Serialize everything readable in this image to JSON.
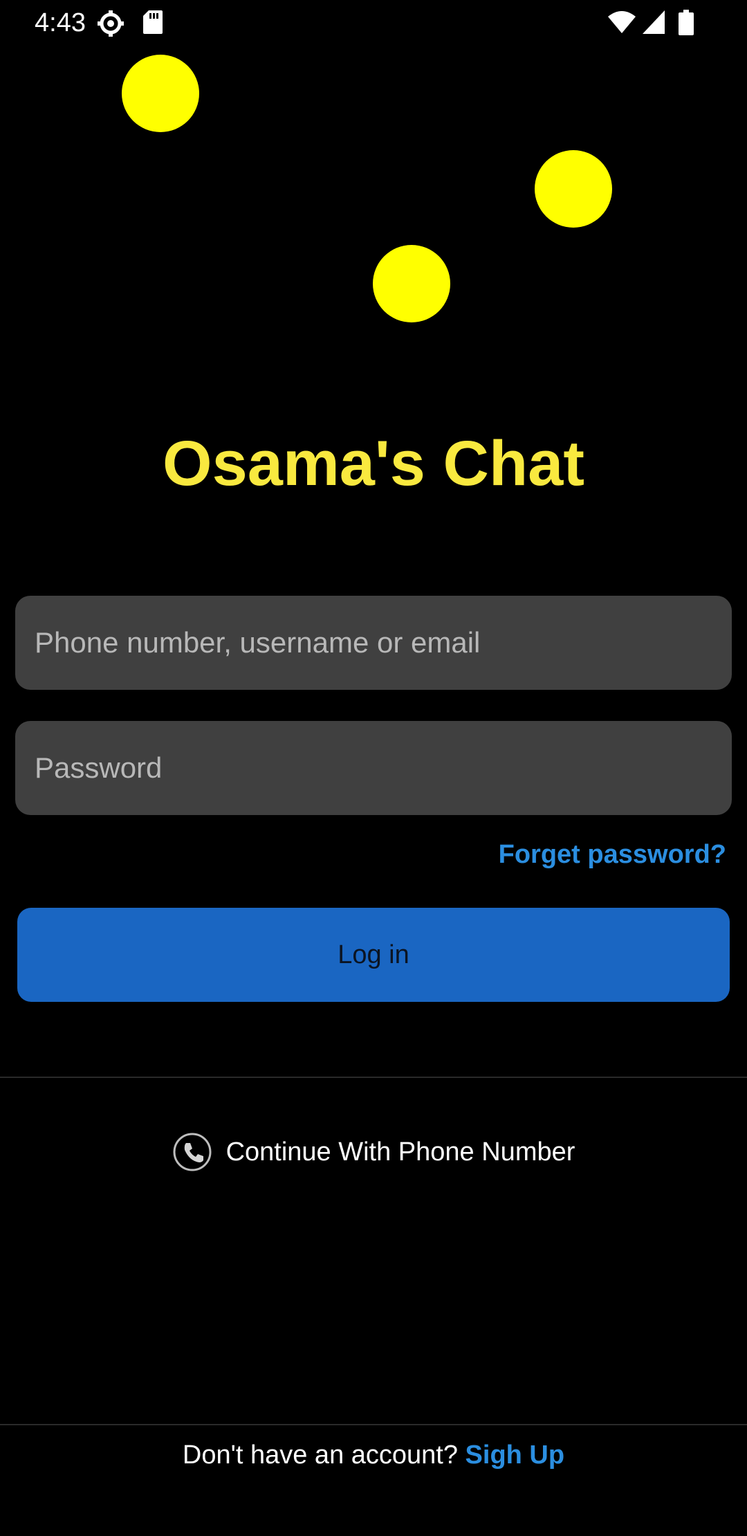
{
  "status_bar": {
    "time": "4:43",
    "icons": [
      "settings-icon",
      "sd-card-icon",
      "wifi-icon",
      "cell-signal-icon",
      "battery-icon"
    ]
  },
  "decorations": {
    "dot_color": "#ffff00",
    "dot_count": 3
  },
  "app": {
    "title": "Osama's Chat",
    "title_color": "#f9e93f"
  },
  "form": {
    "username_placeholder": "Phone number, username or email",
    "password_placeholder": "Password",
    "forgot_password_label": "Forget password?",
    "login_label": "Log in"
  },
  "alt_login": {
    "icon": "phone-icon",
    "label": "Continue With Phone Number"
  },
  "footer": {
    "prompt": "Don't have an account?",
    "signup_label": "Sigh Up"
  },
  "colors": {
    "background": "#000000",
    "input_background": "#404040",
    "primary_button": "#1a66c2",
    "link": "#2b8ee0"
  }
}
